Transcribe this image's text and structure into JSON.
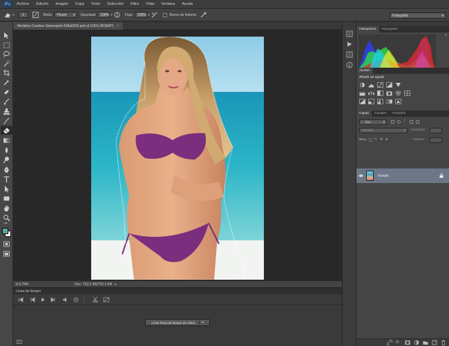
{
  "menubar": {
    "logo": "Ps",
    "items": [
      "Archivo",
      "Edición",
      "Imagen",
      "Capa",
      "Texto",
      "Selección",
      "Filtro",
      "Vista",
      "Ventana",
      "Ayuda"
    ]
  },
  "options": {
    "brush_size": "1",
    "mode_label": "Modo:",
    "mode_value": "Pincel",
    "opacity_label": "Opacidad:",
    "opacity_value": "100%",
    "flow_label": "Flujo:",
    "flow_value": "100%",
    "history_label": "Borrar de historia"
  },
  "workspace": {
    "value": "Fotografía"
  },
  "document": {
    "tab_title": "Modelos-Candice-Swanepoel-428a6002.psd al 115% (RGB/8*)",
    "zoom": "114,79%",
    "doc_info": "Doc: 752,3 KB/752,3 KB"
  },
  "timeline": {
    "title": "Línea de tiempo",
    "create_button": "Crear línea de tiempo de vídeo"
  },
  "panels": {
    "histogram_tab": "Histograma",
    "navigator_tab": "Navegador",
    "adjustments_tab": "Ajustes",
    "adjustments_subtitle": "Añadir un ajuste",
    "layers_tab": "Capas",
    "channels_tab": "Canales",
    "paths_tab": "Trazados",
    "filter_kind": "Tipo",
    "blend_mode": "Normal",
    "opacity_label": "Opacidad:",
    "lock_label": "Bloq.:",
    "fill_label": "Relleno:",
    "layer_name": "Fondo"
  },
  "colors": {
    "foreground": "#5aa7a0",
    "background": "#ffffff",
    "selected_layer": "#6d7788"
  }
}
